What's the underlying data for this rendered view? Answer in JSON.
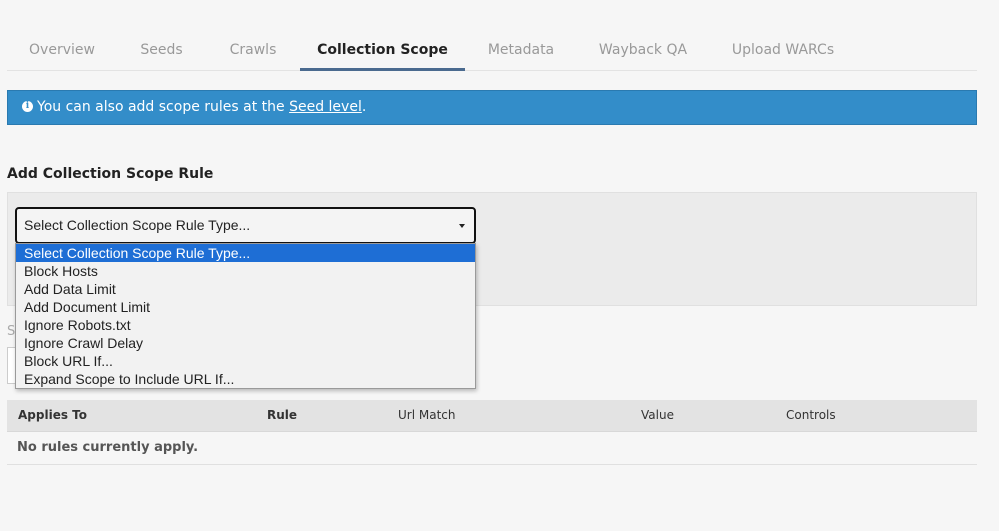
{
  "tabs": {
    "overview": "Overview",
    "seeds": "Seeds",
    "crawls": "Crawls",
    "collection_scope": "Collection Scope",
    "metadata": "Metadata",
    "wayback_qa": "Wayback QA",
    "upload_warcs": "Upload WARCs",
    "active": "Collection Scope"
  },
  "info": {
    "icon": "info-circle-icon",
    "text_before": "You can also add scope rules at the ",
    "link": "Seed level",
    "text_after": "."
  },
  "add_rule": {
    "title": "Add Collection Scope Rule",
    "select_value": "Select Collection Scope Rule Type...",
    "options": [
      "Select Collection Scope Rule Type...",
      "Block Hosts",
      "Add Data Limit",
      "Add Document Limit",
      "Ignore Robots.txt",
      "Ignore Crawl Delay",
      "Block URL If...",
      "Expand Scope to Include URL If..."
    ],
    "partially_hidden_label": "S"
  },
  "rules_table": {
    "headers": {
      "applies_to": "Applies To",
      "rule": "Rule",
      "url_match": "Url Match",
      "value": "Value",
      "controls": "Controls"
    },
    "empty_message": "No rules currently apply."
  },
  "colors": {
    "info_bar": "#338dc9",
    "tab_active_underline": "#4a6a8f",
    "option_selected": "#1e6ed5"
  }
}
